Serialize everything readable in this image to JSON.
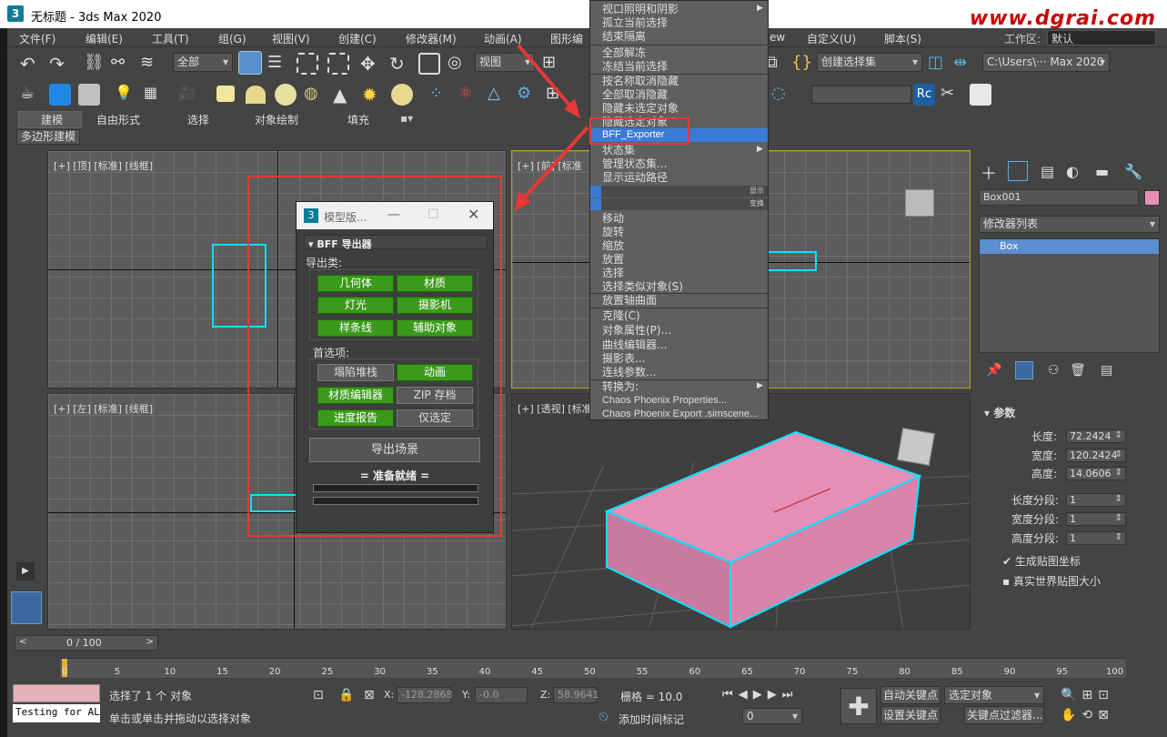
{
  "window": {
    "title": "无标题 - 3ds Max 2020",
    "logo": "3"
  },
  "watermark": "www.dgrai.com",
  "menu": [
    "文件(F)",
    "编辑(E)",
    "工具(T)",
    "组(G)",
    "视图(V)",
    "创建(C)",
    "修改器(M)",
    "动画(A)",
    "图形编",
    "ew",
    "自定义(U)",
    "脚本(S)"
  ],
  "workspace": {
    "label": "工作区:",
    "value": "默认"
  },
  "toolbar": {
    "selection_filter": "全部",
    "ref_coord": "视图",
    "named_selection": "创建选择集",
    "path": "C:\\Users\\··· Max 2020"
  },
  "ribbon_tabs": [
    "建模",
    "自由形式",
    "选择",
    "对象绘制",
    "填充"
  ],
  "subtab": "多边形建模",
  "viewports": {
    "top": "[+] [顶] [标准] [线框]",
    "front": "[+] [前] [标准",
    "left": "[+] [左] [标准] [线框]",
    "persp": "[+] [透视] [标准"
  },
  "context_menu": {
    "items": [
      "视口照明和阴影",
      "孤立当前选择",
      "结束隔离",
      "全部解冻",
      "冻结当前选择",
      "按名称取消隐藏",
      "全部取消隐藏",
      "隐藏未选定对象",
      "隐藏选定对象",
      "BFF_Exporter",
      "状态集",
      "管理状态集...",
      "显示运动路径"
    ],
    "display_label": "显示",
    "transform_label": "变换",
    "transform_items": [
      "移动",
      "旋转",
      "缩放",
      "放置",
      "选择",
      "选择类似对象(S)",
      "放置轴曲面",
      "克隆(C)",
      "对象属性(P)...",
      "曲线编辑器...",
      "摄影表...",
      "连线参数...",
      "转换为:",
      "Chaos Phoenix Properties...",
      "Chaos Phoenix Export .simscene..."
    ]
  },
  "dialog": {
    "title": "模型版...",
    "rollout": "BFF 导出器",
    "export_types_label": "导出类:",
    "export_types": [
      "几何体",
      "材质",
      "灯光",
      "摄影机",
      "样条线",
      "辅助对象"
    ],
    "prefs_label": "首选项:",
    "prefs": [
      {
        "label": "塌陷堆栈",
        "on": false
      },
      {
        "label": "动画",
        "on": true
      },
      {
        "label": "材质编辑器",
        "on": true
      },
      {
        "label": "ZIP 存档",
        "on": false
      },
      {
        "label": "进度报告",
        "on": true
      },
      {
        "label": "仅选定",
        "on": false
      }
    ],
    "export_button": "导出场景",
    "status": "= 准备就绪 ="
  },
  "command_panel": {
    "object_name": "Box001",
    "modifier_list": "修改器列表",
    "stack_item": "Box",
    "params_title": "参数",
    "length": {
      "label": "长度:",
      "value": "72.2424"
    },
    "width": {
      "label": "宽度:",
      "value": "120.2424"
    },
    "height": {
      "label": "高度:",
      "value": "14.0606"
    },
    "length_segs": {
      "label": "长度分段:",
      "value": "1"
    },
    "width_segs": {
      "label": "宽度分段:",
      "value": "1"
    },
    "height_segs": {
      "label": "高度分段:",
      "value": "1"
    },
    "gen_uv": "生成贴图坐标",
    "real_world": "真实世界贴图大小"
  },
  "timeline": {
    "frame": "0 / 100",
    "ticks": [
      "0",
      "5",
      "10",
      "15",
      "20",
      "25",
      "30",
      "35",
      "40",
      "45",
      "50",
      "55",
      "60",
      "65",
      "70",
      "75",
      "80",
      "85",
      "90",
      "95",
      "100"
    ]
  },
  "status": {
    "maxscript": "Testing for AL",
    "selected": "选择了 1 个 对象",
    "prompt": "单击或单击并拖动以选择对象",
    "x_label": "X:",
    "x": "-128.2868",
    "y_label": "Y:",
    "y": "-0.0",
    "z_label": "Z:",
    "z": "58.9641",
    "grid": "栅格 = 10.0",
    "add_time_tag": "添加时间标记",
    "auto_key": "自动关键点",
    "selected_obj": "选定对象",
    "set_key": "设置关键点",
    "key_filters": "关键点过滤器...",
    "frame_field": "0"
  },
  "colors": {
    "box_fill": "#e58fb7",
    "select": "#00e5ff",
    "highlight": "#3a7bd5",
    "green": "#3a9a1a",
    "red": "#e53935"
  }
}
